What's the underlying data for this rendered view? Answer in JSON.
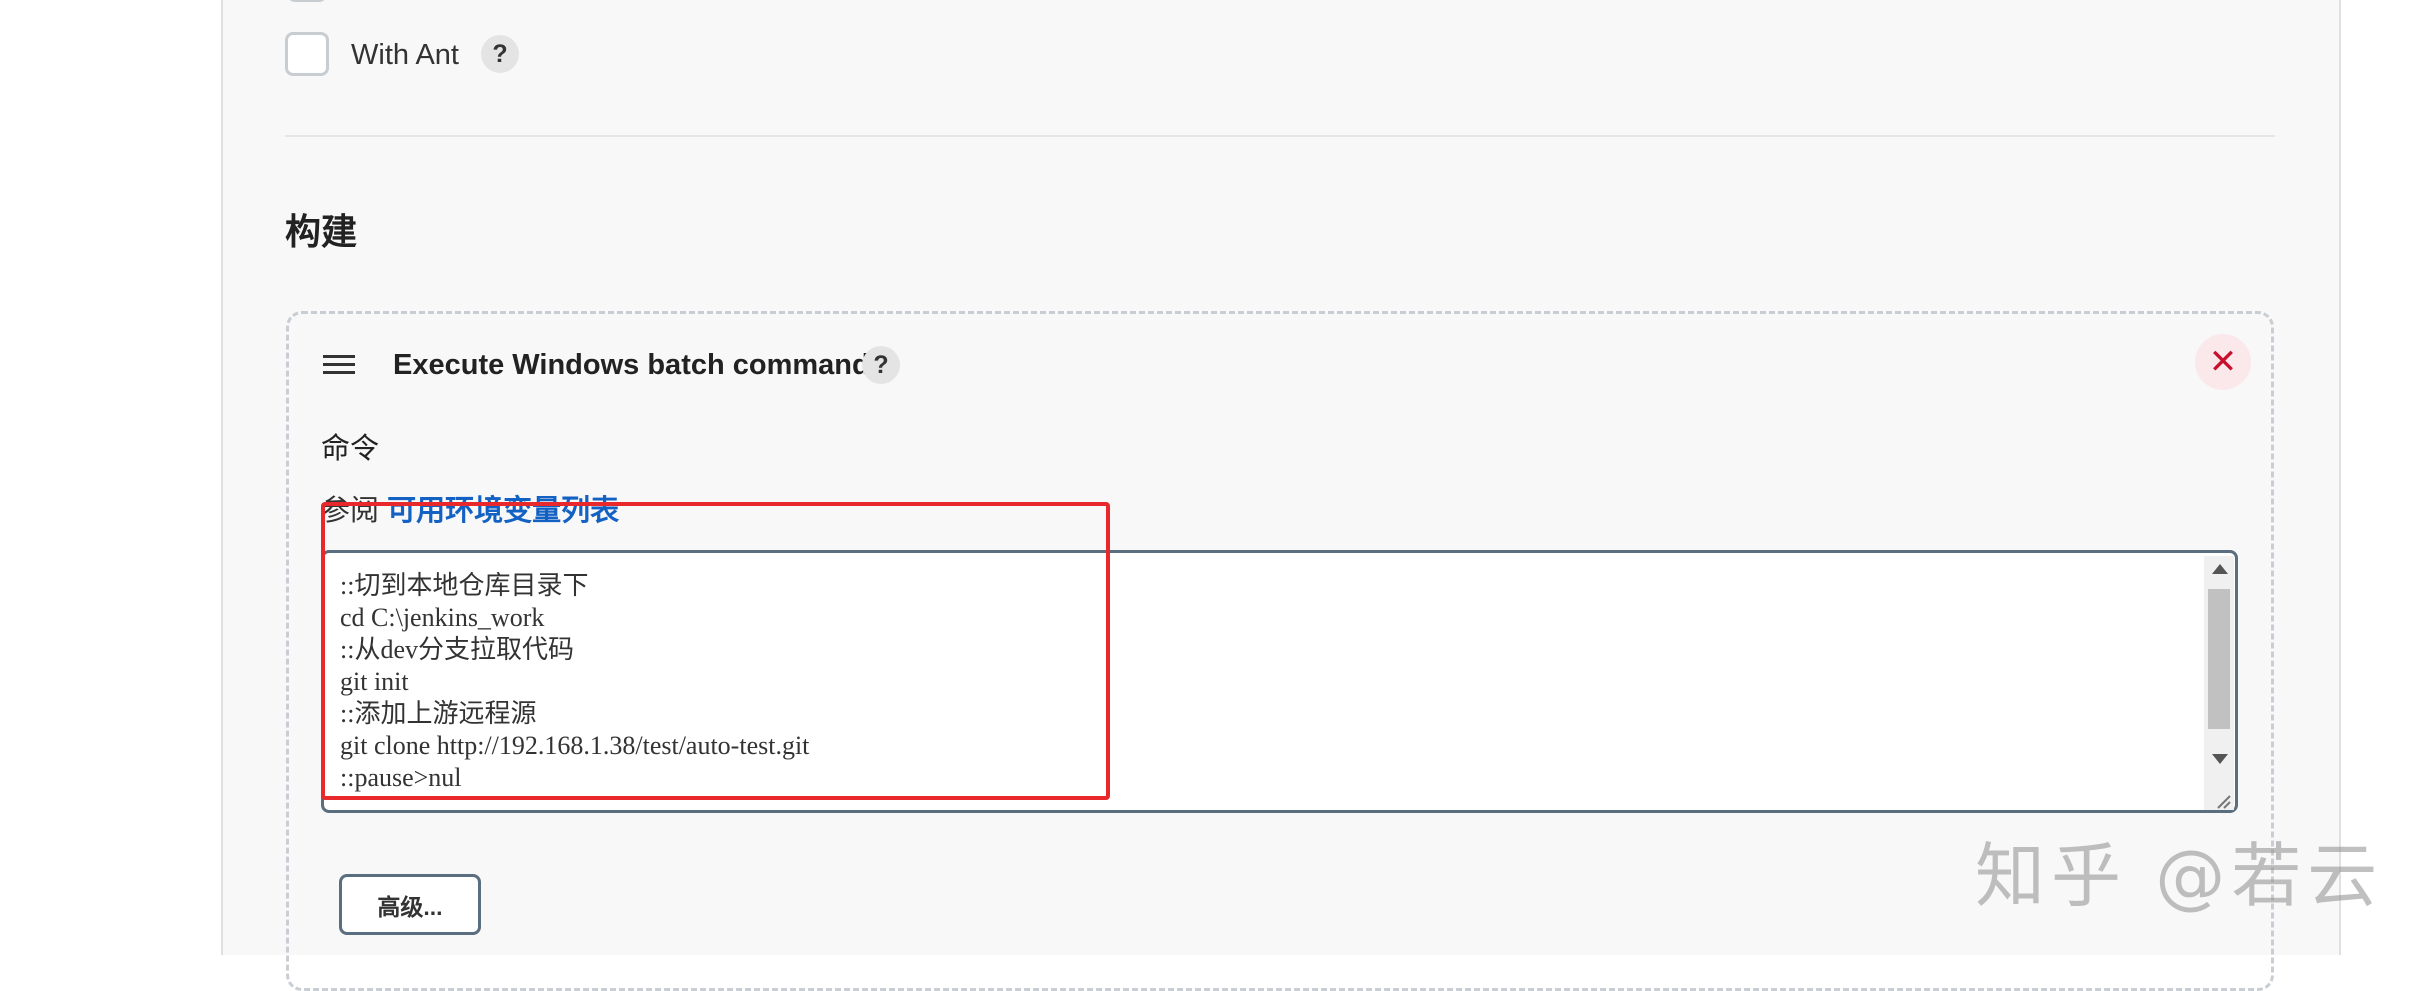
{
  "options": {
    "with_ant_label": "With Ant",
    "help_glyph": "?"
  },
  "build": {
    "section_title": "构建",
    "step": {
      "title": "Execute Windows batch command",
      "help_glyph": "?",
      "close_glyph": "✕",
      "command_label": "命令",
      "see_also_prefix": "参阅",
      "see_also_link": "可用环境变量列表",
      "command_text": "::切到本地仓库目录下\ncd C:\\jenkins_work\n::从dev分支拉取代码\ngit init\n::添加上游远程源\ngit clone http://192.168.1.38/test/auto-test.git\n::pause>nul",
      "advanced_button": "高级..."
    }
  },
  "watermark": "知乎 @若云",
  "colors": {
    "annotation_red": "#e8282a",
    "link_blue": "#1461c4",
    "close_red": "#c8102e"
  },
  "icons": [
    "drag-handle-icon",
    "help-icon",
    "close-icon",
    "resize-grip-icon"
  ]
}
